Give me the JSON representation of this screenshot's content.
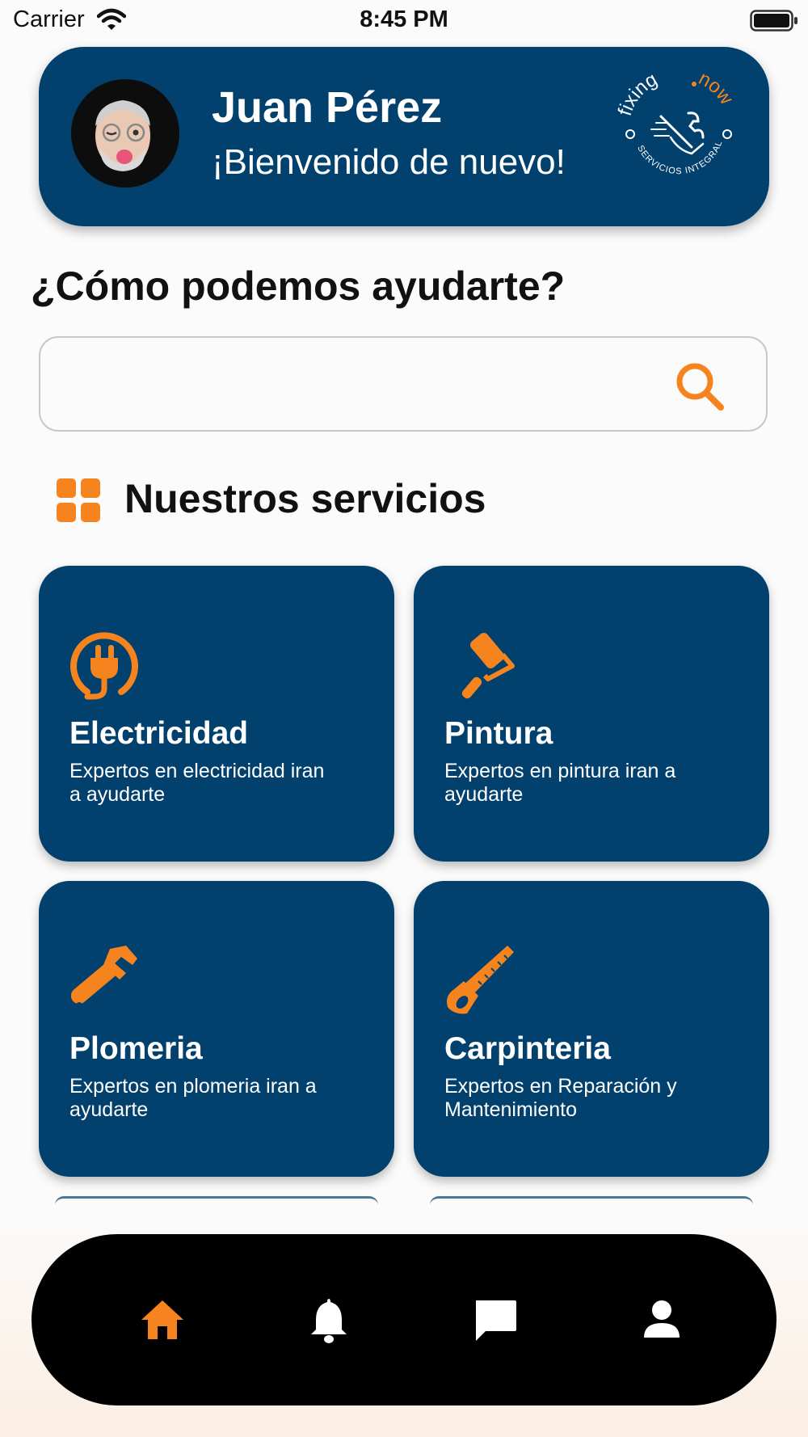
{
  "status_bar": {
    "carrier": "Carrier",
    "time": "8:45 PM"
  },
  "header": {
    "user_name": "Juan Pérez",
    "welcome": "¡Bienvenido de nuevo!",
    "logo_text_top": "fixing",
    "logo_text_accent": "now",
    "logo_tagline": "SERVICIOS INTEGRALES"
  },
  "help_title": "¿Cómo podemos ayudarte?",
  "search": {
    "value": "",
    "placeholder": ""
  },
  "services_title": "Nuestros servicios",
  "services": [
    {
      "title": "Electricidad",
      "description": "Expertos en electricidad iran a ayudarte",
      "icon": "plug-icon"
    },
    {
      "title": "Pintura",
      "description": "Expertos en pintura iran a ayudarte",
      "icon": "paint-roller-icon"
    },
    {
      "title": "Plomeria",
      "description": "Expertos en plomeria iran a ayudarte",
      "icon": "pipe-wrench-icon"
    },
    {
      "title": "Carpinteria",
      "description": "Expertos en Reparación y Mantenimiento",
      "icon": "saw-icon"
    }
  ],
  "tab_bar": {
    "items": [
      "home-icon",
      "bell-icon",
      "chat-icon",
      "profile-icon"
    ],
    "active": "home-icon"
  },
  "colors": {
    "primary": "#02416d",
    "accent": "#f5841f",
    "tabbar": "#000000",
    "background": "#fbfbfb"
  }
}
